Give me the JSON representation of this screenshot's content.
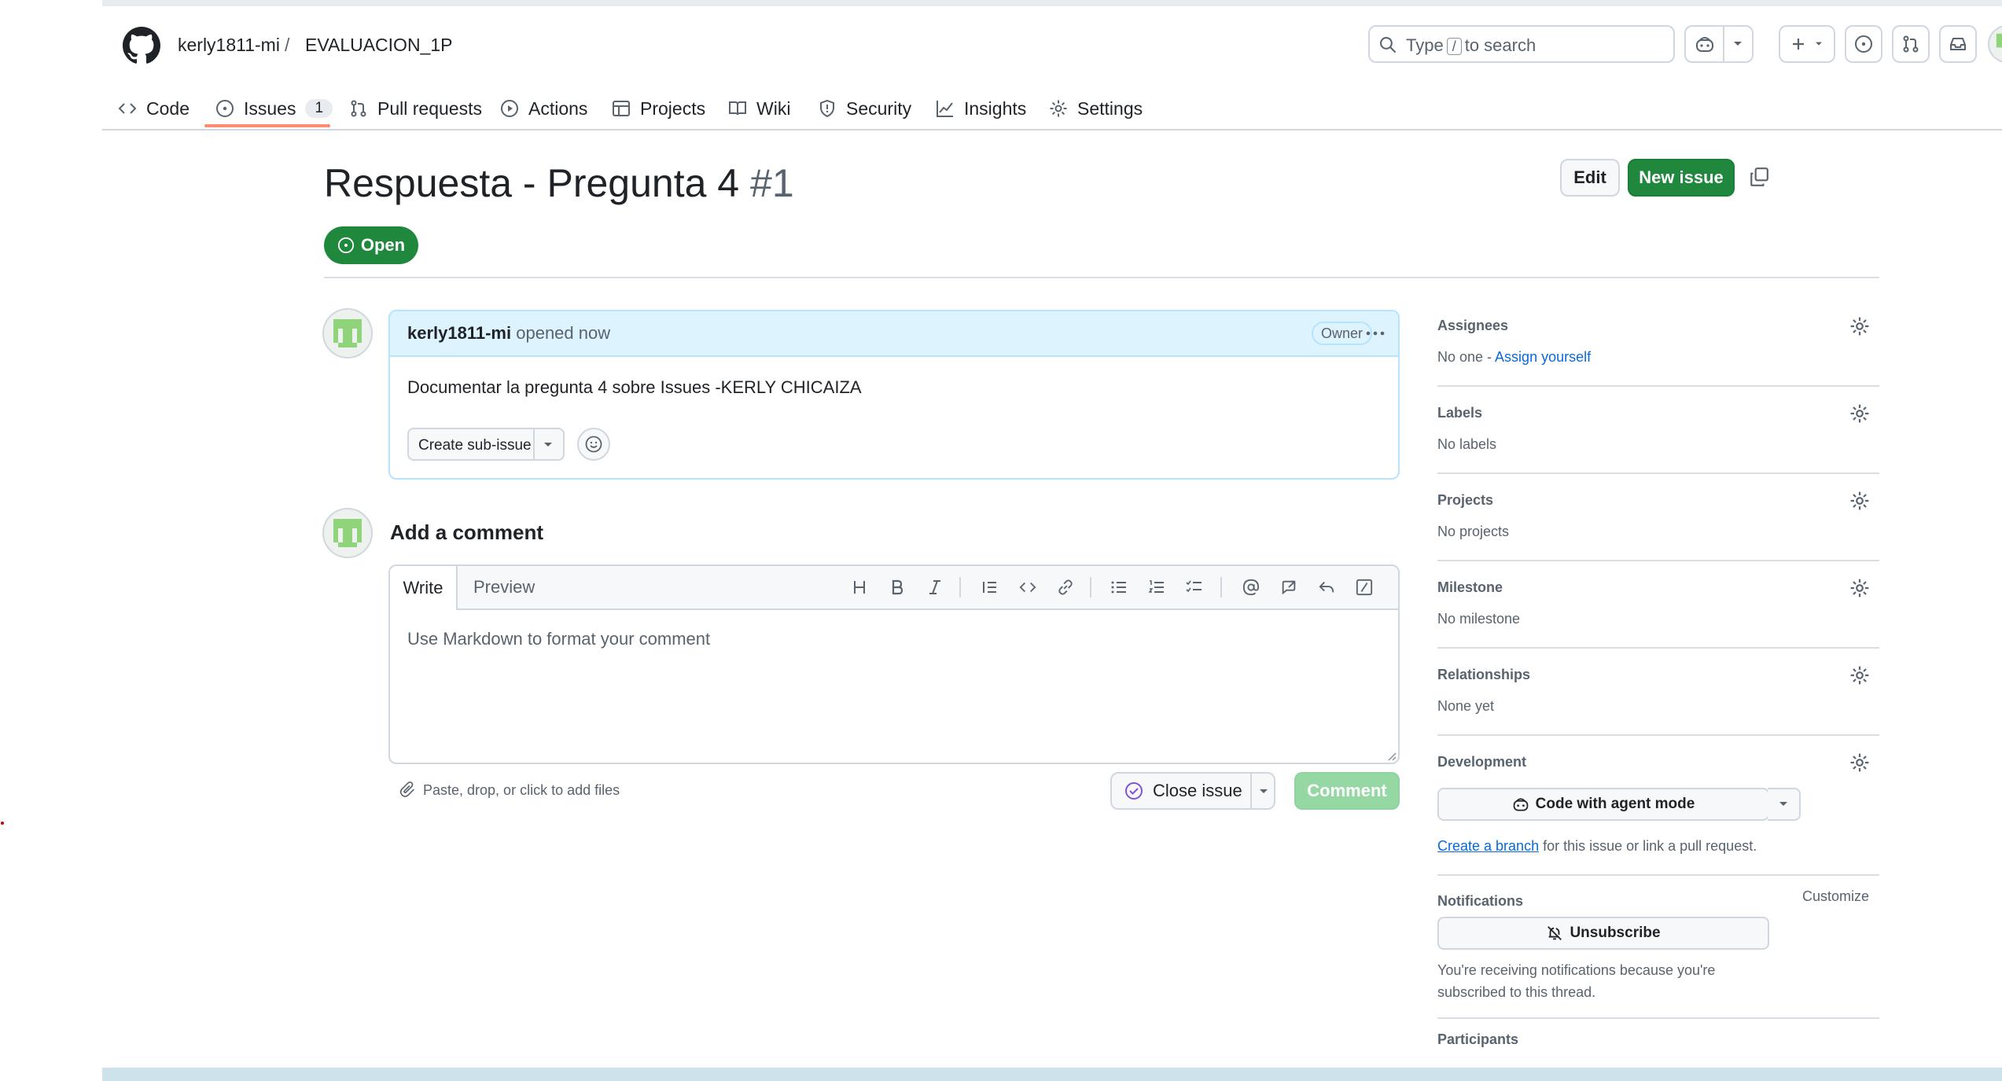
{
  "header": {
    "owner": "kerly1811-mi",
    "separator": "/",
    "repo": "EVALUACION_1P",
    "search_pre": "Type",
    "search_key": "/",
    "search_post": "to search"
  },
  "tabs": [
    {
      "label": "Code"
    },
    {
      "label": "Issues",
      "count": "1"
    },
    {
      "label": "Pull requests"
    },
    {
      "label": "Actions"
    },
    {
      "label": "Projects"
    },
    {
      "label": "Wiki"
    },
    {
      "label": "Security"
    },
    {
      "label": "Insights"
    },
    {
      "label": "Settings"
    }
  ],
  "issue": {
    "title": "Respuesta - Pregunta 4",
    "number": "#1",
    "state": "Open",
    "edit_label": "Edit",
    "new_issue_label": "New issue"
  },
  "comment": {
    "author": "kerly1811-mi",
    "action": "opened now",
    "role": "Owner",
    "body": "Documentar la pregunta 4 sobre Issues -KERLY CHICAIZA",
    "sub_issue_label": "Create sub-issue"
  },
  "composer": {
    "heading": "Add a comment",
    "write_tab": "Write",
    "preview_tab": "Preview",
    "placeholder": "Use Markdown to format your comment",
    "attach_hint": "Paste, drop, or click to add files",
    "close_label": "Close issue",
    "comment_label": "Comment"
  },
  "sidebar": {
    "assignees": {
      "label": "Assignees",
      "value": "No one - ",
      "link": "Assign yourself"
    },
    "labels": {
      "label": "Labels",
      "value": "No labels"
    },
    "projects": {
      "label": "Projects",
      "value": "No projects"
    },
    "milestone": {
      "label": "Milestone",
      "value": "No milestone"
    },
    "relationships": {
      "label": "Relationships",
      "value": "None yet"
    },
    "development": {
      "label": "Development",
      "button": "Code with agent mode",
      "link": "Create a branch",
      "text": " for this issue or link a pull request."
    },
    "notifications": {
      "label": "Notifications",
      "customize": "Customize",
      "button": "Unsubscribe",
      "text1": "You're receiving notifications because you're",
      "text2": "subscribed to this thread."
    },
    "participants": {
      "label": "Participants"
    }
  },
  "colors": {
    "accent_green": "#1f883d",
    "link_blue": "#0969da",
    "tab_underline": "#fd8c73"
  }
}
